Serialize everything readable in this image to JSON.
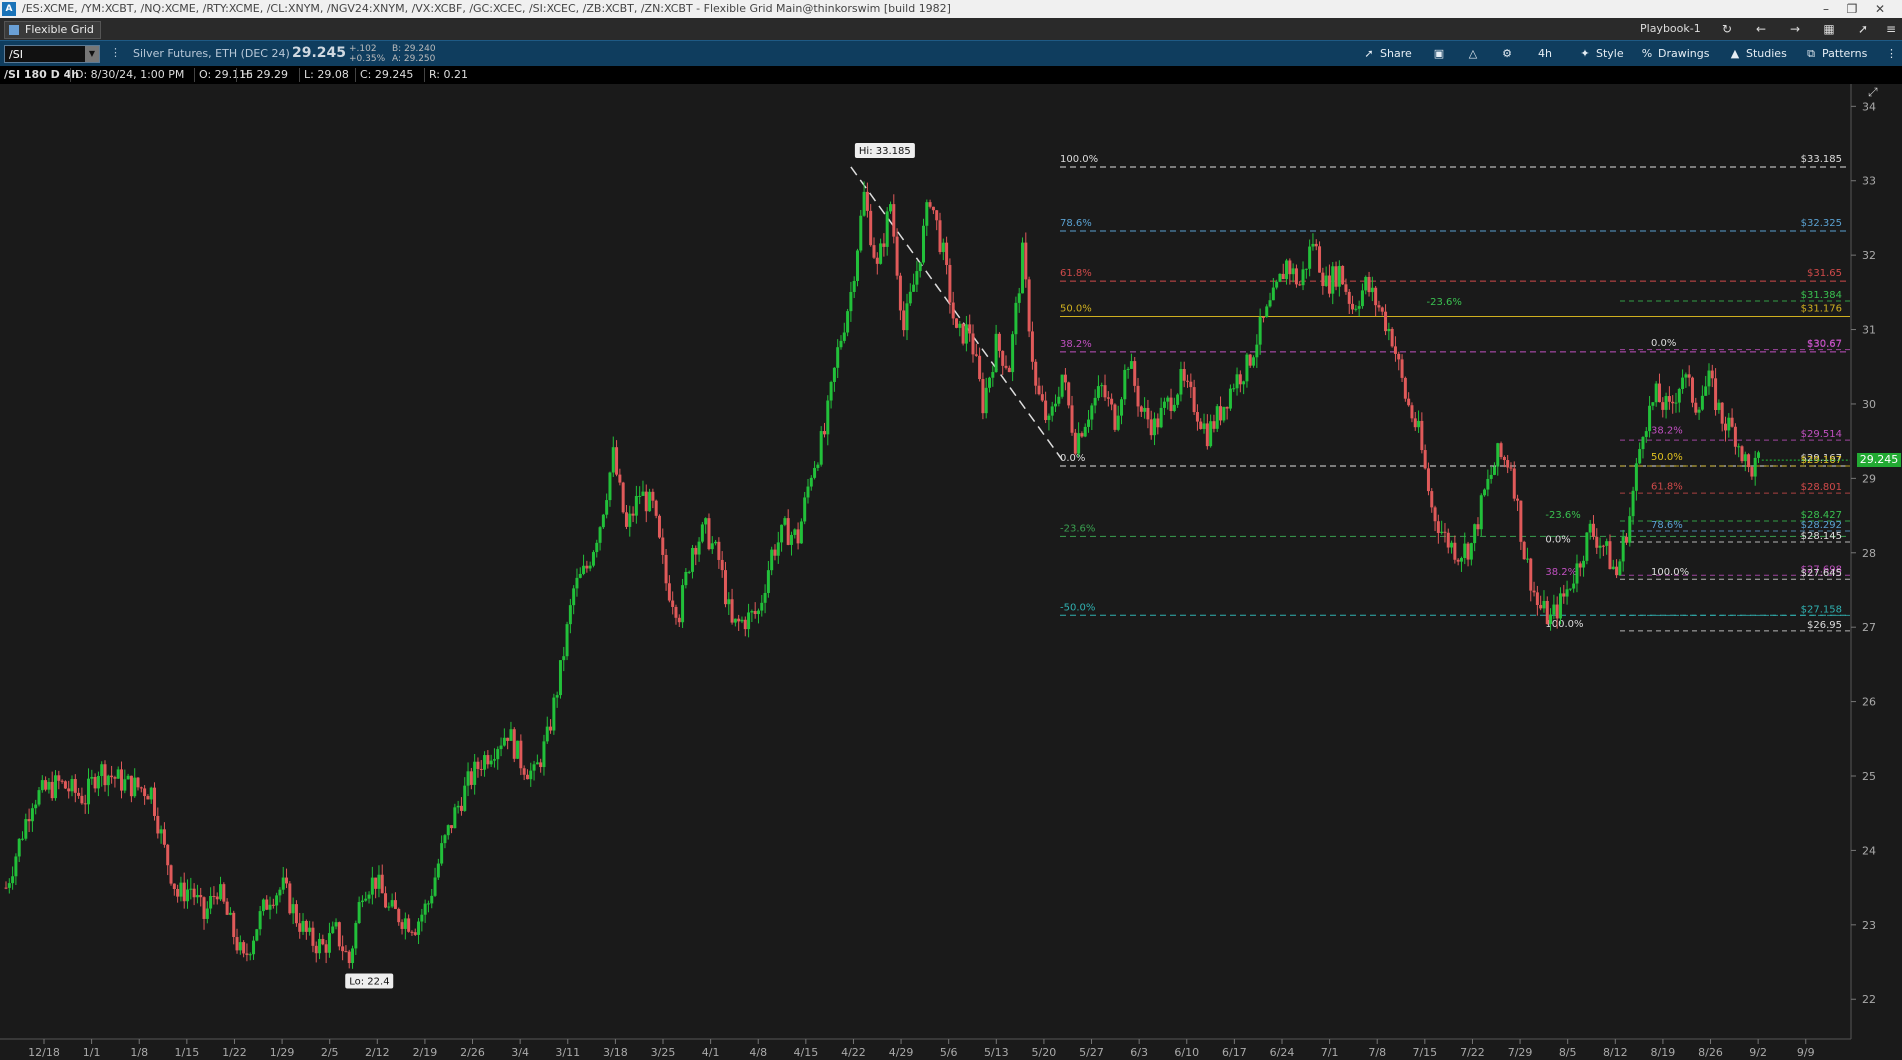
{
  "window": {
    "title": "/ES:XCME, /YM:XCBT, /NQ:XCME, /RTY:XCME, /CL:XNYM, /NGV24:XNYM, /VX:XCBF, /GC:XCEC, /SI:XCEC, /ZB:XCBT, /ZN:XCBT - Flexible Grid Main@thinkorswim [build 1982]",
    "logo": "A"
  },
  "tabbar": {
    "grid_tab": "Flexible Grid",
    "playbook": "Playbook-1"
  },
  "toolbar": {
    "symbol": "/SI",
    "description": "Silver Futures, ETH (DEC 24)",
    "last_price": "29.245",
    "change": "+.102",
    "change_pct": "+0.35%",
    "bid": "B: 29.240",
    "ask": "A: 29.250",
    "share": "Share",
    "timeframe": "4h",
    "style": "Style",
    "drawings": "Drawings",
    "studies": "Studies",
    "patterns": "Patterns"
  },
  "infobar": {
    "chart_id": "/SI 180 D 4h",
    "date": "D: 8/30/24, 1:00 PM",
    "open": "O: 29.115",
    "high": "H: 29.29",
    "low": "L: 29.08",
    "close": "C: 29.245",
    "range": "R: 0.21"
  },
  "chart_data": {
    "type": "candlestick",
    "symbol": "/SI",
    "ylim": [
      21.6,
      34.3
    ],
    "y_ticks": [
      22,
      23,
      24,
      25,
      26,
      27,
      28,
      29,
      30,
      31,
      32,
      33,
      34
    ],
    "x_ticks": [
      "12/18",
      "1/1",
      "1/8",
      "1/15",
      "1/22",
      "1/29",
      "2/5",
      "2/12",
      "2/19",
      "2/26",
      "3/4",
      "3/11",
      "3/18",
      "3/25",
      "4/1",
      "4/8",
      "4/15",
      "4/22",
      "4/29",
      "5/6",
      "5/13",
      "5/20",
      "5/27",
      "6/3",
      "6/10",
      "6/17",
      "6/24",
      "7/1",
      "7/8",
      "7/15",
      "7/22",
      "7/29",
      "8/5",
      "8/12",
      "8/19",
      "8/26",
      "9/2",
      "9/9"
    ],
    "price_path": [
      [
        0,
        23.5
      ],
      [
        2,
        24.7
      ],
      [
        4,
        24.9
      ],
      [
        6,
        24.7
      ],
      [
        7,
        25.1
      ],
      [
        9,
        24.9
      ],
      [
        11,
        24.8
      ],
      [
        12,
        24.0
      ],
      [
        13,
        23.4
      ],
      [
        14,
        23.5
      ],
      [
        15,
        23.1
      ],
      [
        16,
        23.5
      ],
      [
        17,
        23.0
      ],
      [
        18,
        22.5
      ],
      [
        19,
        23.0
      ],
      [
        20,
        23.4
      ],
      [
        21,
        23.5
      ],
      [
        22,
        23.1
      ],
      [
        23,
        22.8
      ],
      [
        24,
        22.7
      ],
      [
        25,
        22.9
      ],
      [
        26,
        22.5
      ],
      [
        27,
        23.5
      ],
      [
        28,
        23.6
      ],
      [
        29,
        23.2
      ],
      [
        30,
        23.1
      ],
      [
        31,
        23.0
      ],
      [
        32,
        23.3
      ],
      [
        33,
        24.0
      ],
      [
        34,
        24.5
      ],
      [
        35,
        24.9
      ],
      [
        36,
        25.2
      ],
      [
        37,
        25.4
      ],
      [
        38,
        25.6
      ],
      [
        39,
        25.2
      ],
      [
        40,
        25.0
      ],
      [
        41,
        25.5
      ],
      [
        42,
        26.4
      ],
      [
        43,
        27.5
      ],
      [
        44,
        27.8
      ],
      [
        45,
        28.4
      ],
      [
        46,
        29.3
      ],
      [
        47,
        28.3
      ],
      [
        48,
        28.8
      ],
      [
        49,
        28.6
      ],
      [
        50,
        27.6
      ],
      [
        51,
        27.2
      ],
      [
        52,
        28.1
      ],
      [
        53,
        28.3
      ],
      [
        54,
        27.9
      ],
      [
        55,
        27.0
      ],
      [
        56,
        27.1
      ],
      [
        57,
        27.2
      ],
      [
        58,
        28.0
      ],
      [
        59,
        28.3
      ],
      [
        60,
        28.2
      ],
      [
        61,
        29.1
      ],
      [
        62,
        29.6
      ],
      [
        63,
        30.7
      ],
      [
        64,
        31.5
      ],
      [
        65,
        32.8
      ],
      [
        66,
        31.8
      ],
      [
        67,
        32.7
      ],
      [
        68,
        31.0
      ],
      [
        69,
        31.8
      ],
      [
        70,
        32.8
      ],
      [
        71,
        32.0
      ],
      [
        72,
        30.9
      ],
      [
        73,
        31.0
      ],
      [
        74,
        30.0
      ],
      [
        75,
        30.8
      ],
      [
        76,
        30.5
      ],
      [
        77,
        32.0
      ],
      [
        78,
        30.2
      ],
      [
        79,
        29.7
      ],
      [
        80,
        30.4
      ],
      [
        81,
        29.5
      ],
      [
        82,
        29.9
      ],
      [
        83,
        30.2
      ],
      [
        84,
        29.8
      ],
      [
        85,
        30.6
      ],
      [
        86,
        29.9
      ],
      [
        87,
        29.7
      ],
      [
        88,
        30.0
      ],
      [
        89,
        30.3
      ],
      [
        90,
        30.0
      ],
      [
        91,
        29.6
      ],
      [
        92,
        29.9
      ],
      [
        93,
        30.3
      ],
      [
        94,
        30.5
      ],
      [
        95,
        31.0
      ],
      [
        96,
        31.4
      ],
      [
        97,
        31.9
      ],
      [
        98,
        31.6
      ],
      [
        99,
        32.2
      ],
      [
        100,
        31.6
      ],
      [
        101,
        31.8
      ],
      [
        102,
        31.3
      ],
      [
        103,
        31.6
      ],
      [
        104,
        31.3
      ],
      [
        105,
        30.9
      ],
      [
        106,
        30.1
      ],
      [
        107,
        29.6
      ],
      [
        108,
        28.6
      ],
      [
        109,
        28.2
      ],
      [
        110,
        28.0
      ],
      [
        111,
        28.1
      ],
      [
        112,
        28.8
      ],
      [
        113,
        29.3
      ],
      [
        114,
        29.2
      ],
      [
        115,
        28.0
      ],
      [
        116,
        27.3
      ],
      [
        117,
        27.1
      ],
      [
        118,
        27.4
      ],
      [
        119,
        27.8
      ],
      [
        120,
        28.3
      ],
      [
        121,
        28.1
      ],
      [
        122,
        27.7
      ],
      [
        123,
        28.5
      ],
      [
        124,
        29.7
      ],
      [
        125,
        30.1
      ],
      [
        126,
        29.9
      ],
      [
        127,
        30.4
      ],
      [
        128,
        30.0
      ],
      [
        129,
        30.3
      ],
      [
        130,
        29.8
      ],
      [
        131,
        29.6
      ],
      [
        132,
        29.1
      ],
      [
        133,
        29.245
      ]
    ],
    "x_max_index": 139,
    "hi_label": "Hi: 33.185",
    "lo_label": "Lo: 22.4",
    "fib_major": {
      "levels": [
        {
          "pct": "100.0%",
          "price": 33.185,
          "label": "$33.185",
          "color": "#dddddd",
          "dash": true
        },
        {
          "pct": "78.6%",
          "price": 32.325,
          "label": "$32.325",
          "color": "#5aa0d0",
          "dash": true
        },
        {
          "pct": "61.8%",
          "price": 31.65,
          "label": "$31.65",
          "color": "#d04a4a",
          "dash": true
        },
        {
          "pct": "50.0%",
          "price": 31.176,
          "label": "$31.176",
          "color": "#d0b020",
          "dash": false
        },
        {
          "pct": "38.2%",
          "price": 30.7,
          "label": "$30.67",
          "color": "#c050c0",
          "dash": true
        },
        {
          "pct": "0.0%",
          "price": 29.167,
          "label": "$29.167",
          "color": "#dddddd",
          "dash": true
        },
        {
          "pct": "-23.6%",
          "price": 28.22,
          "label": "",
          "color": "#3aa050",
          "dash": true
        },
        {
          "pct": "-50.0%",
          "price": 27.16,
          "label": "",
          "color": "#30b0b0",
          "dash": true
        }
      ]
    },
    "fib_right_labels": [
      {
        "price": 31.384,
        "label": "$31.384",
        "color": "#3ac050"
      },
      {
        "price": 30.73,
        "label": "$30.67",
        "color": "#c050c0"
      },
      {
        "price": 29.514,
        "label": "$29.514",
        "color": "#c050c0"
      },
      {
        "price": 29.167,
        "label": "$29.167",
        "color": "#e0c020"
      },
      {
        "price": 28.801,
        "label": "$28.801",
        "color": "#d04a4a"
      },
      {
        "price": 28.427,
        "label": "$28.427",
        "color": "#3ac050"
      },
      {
        "price": 28.292,
        "label": "$28.292",
        "color": "#5aa0d0"
      },
      {
        "price": 28.145,
        "label": "$28.145",
        "color": "#dddddd"
      },
      {
        "price": 27.698,
        "label": "$27.698",
        "color": "#c050c0"
      },
      {
        "price": 27.645,
        "label": "$27.645",
        "color": "#dddddd"
      },
      {
        "price": 27.158,
        "label": "$27.158",
        "color": "#30b0b0"
      },
      {
        "price": 26.95,
        "label": "$26.95",
        "color": "#dddddd"
      }
    ],
    "fib_small_labels": [
      {
        "idx": 124,
        "price": 30.78,
        "text": "0.0%",
        "color": "#dddddd"
      },
      {
        "idx": 107,
        "price": 31.33,
        "text": "-23.6%",
        "color": "#3ac050"
      },
      {
        "idx": 124,
        "price": 29.6,
        "text": "38.2%",
        "color": "#c050c0"
      },
      {
        "idx": 124,
        "price": 29.25,
        "text": "50.0%",
        "color": "#e0c020"
      },
      {
        "idx": 124,
        "price": 28.85,
        "text": "61.8%",
        "color": "#d04a4a"
      },
      {
        "idx": 116,
        "price": 28.47,
        "text": "-23.6%",
        "color": "#3ac050"
      },
      {
        "idx": 124,
        "price": 28.33,
        "text": "78.6%",
        "color": "#5aa0d0"
      },
      {
        "idx": 116,
        "price": 28.14,
        "text": "0.0%",
        "color": "#dddddd"
      },
      {
        "idx": 116,
        "price": 27.7,
        "text": "38.2%",
        "color": "#c050c0"
      },
      {
        "idx": 124,
        "price": 27.7,
        "text": "100.0%",
        "color": "#dddddd"
      },
      {
        "idx": 116,
        "price": 27.0,
        "text": "100.0%",
        "color": "#dddddd"
      }
    ],
    "last_price_label": "29.245"
  }
}
